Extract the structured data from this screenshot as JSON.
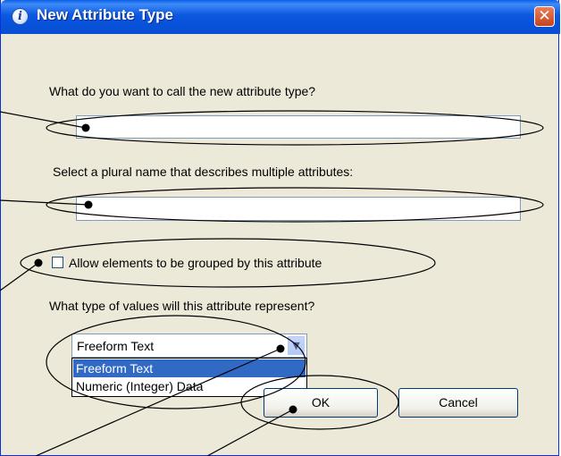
{
  "dialog": {
    "title": "New Attribute Type",
    "close_glyph": "✕",
    "info_glyph": "i"
  },
  "form": {
    "name_label": "What do you want to call the new attribute type?",
    "name_value": "",
    "plural_label": "Select a plural name that describes multiple attributes:",
    "plural_value": "",
    "group_checkbox_label": "Allow elements to be grouped by this attribute",
    "group_checked": false,
    "value_type_label": "What type of values will this attribute represent?",
    "value_type_selected": "Freeform Text",
    "value_type_options": [
      "Freeform Text",
      "Numeric (Integer) Data"
    ]
  },
  "buttons": {
    "ok_label": "OK",
    "cancel_label": "Cancel"
  },
  "icons": [
    "info-icon",
    "close-icon",
    "chevron-down-icon"
  ],
  "colors": {
    "titlebar": "#0a5fe8",
    "close_button": "#d65a30",
    "selection": "#316ac5",
    "dialog_bg": "#ece9d8"
  }
}
